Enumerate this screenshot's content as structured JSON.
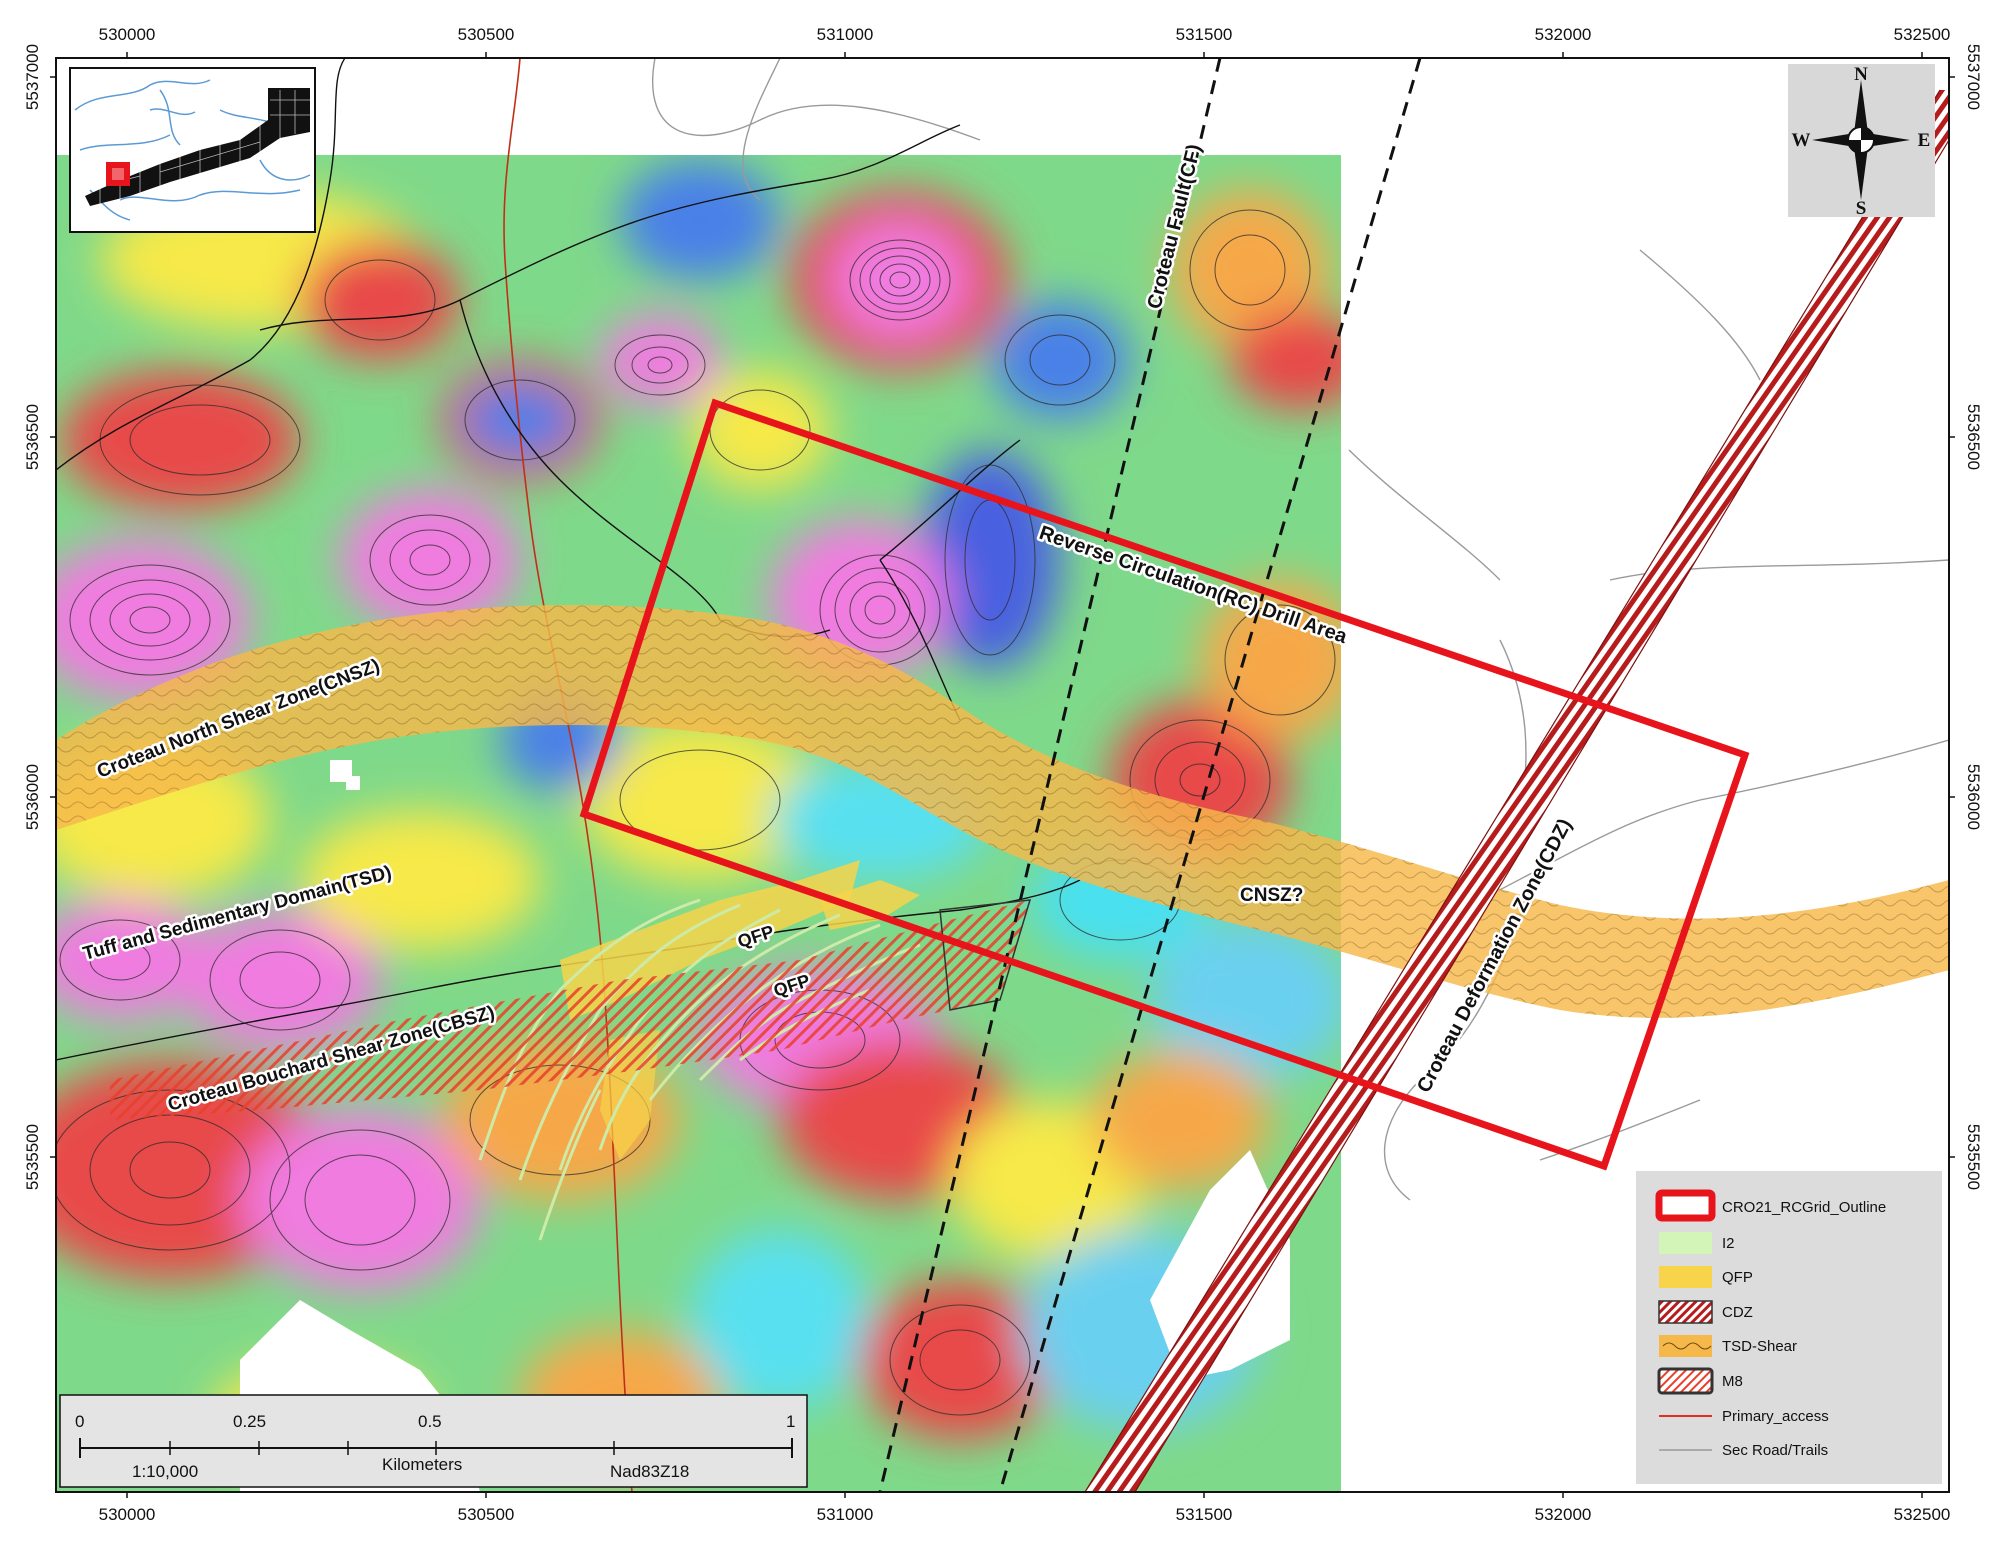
{
  "axes": {
    "x_ticks": [
      "530000",
      "530500",
      "531000",
      "531500",
      "532000",
      "532500"
    ],
    "y_ticks": [
      "5537000",
      "5536500",
      "5536000",
      "5535500"
    ]
  },
  "labels": {
    "cnsz": "Croteau North Shear Zone(CNSZ)",
    "tsd": "Tuff and Sedimentary Domain(TSD)",
    "cbsz": "Croteau Bouchard Shear Zone(CBSZ)",
    "qfp1": "QFP",
    "qfp2": "QFP",
    "cnsz_q": "CNSZ?",
    "cf": "Croteau Fault(CF)",
    "cdz": "Croteau Deformation Zone(CDZ)",
    "rc": "Reverse Circulation(RC) Drill Area"
  },
  "compass": {
    "n": "N",
    "s": "S",
    "e": "E",
    "w": "W",
    "icon": "north-arrow-icon"
  },
  "scalebar": {
    "ticks": [
      "0",
      "0.25",
      "0.5",
      "1"
    ],
    "ratio": "1:10,000",
    "units": "Kilometers",
    "datum": "Nad83Z18"
  },
  "legend": {
    "items": [
      {
        "label": "CRO21_RCGrid_Outline",
        "color": "#e8141c"
      },
      {
        "label": "I2",
        "color": "#d4f5b8"
      },
      {
        "label": "QFP",
        "color": "#f7d44a"
      },
      {
        "label": "CDZ",
        "color": "#b71c1c"
      },
      {
        "label": "TSD-Shear",
        "color": "#f7b84a"
      },
      {
        "label": "M8",
        "color": "#ea5a4a"
      },
      {
        "label": "Primary_access",
        "color": "#e03020"
      },
      {
        "label": "Sec Road/Trails",
        "color": "#9a9a9a"
      }
    ]
  }
}
